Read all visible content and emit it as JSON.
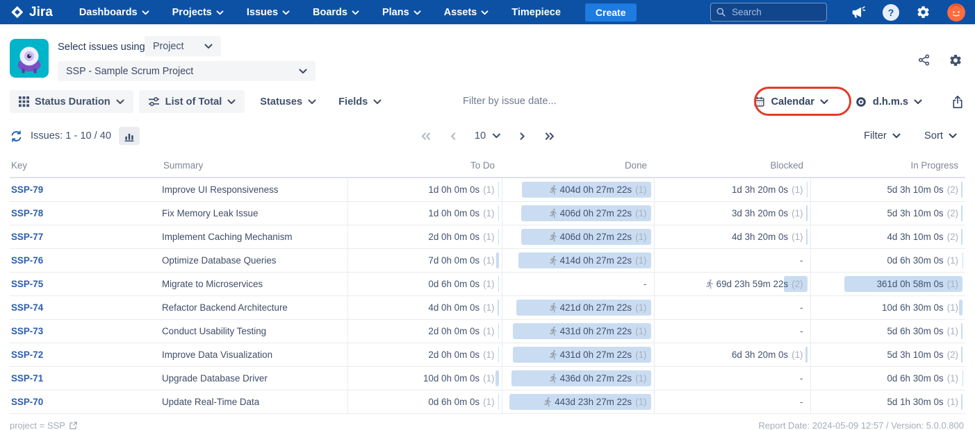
{
  "navbar": {
    "brand": "Jira",
    "items": [
      {
        "label": "Dashboards",
        "chevron": true
      },
      {
        "label": "Projects",
        "chevron": true
      },
      {
        "label": "Issues",
        "chevron": true
      },
      {
        "label": "Boards",
        "chevron": true
      },
      {
        "label": "Plans",
        "chevron": true
      },
      {
        "label": "Assets",
        "chevron": true
      },
      {
        "label": "Timepiece",
        "chevron": false
      }
    ],
    "create_label": "Create",
    "search_placeholder": "Search"
  },
  "selector": {
    "label": "Select issues using",
    "mode_value": "Project",
    "project_value": "SSP - Sample Scrum Project"
  },
  "toolbar": {
    "report_type": "Status Duration",
    "view": "List of Total",
    "statuses": "Statuses",
    "fields": "Fields",
    "date_filter": "Filter by issue date...",
    "calendar": "Calendar",
    "time_format": "d.h.m.s"
  },
  "pager": {
    "issues_label": "Issues: 1 - 10 / 40",
    "page_size": "10",
    "filter": "Filter",
    "sort": "Sort"
  },
  "table": {
    "columns": [
      "Key",
      "Summary",
      "To Do",
      "Done",
      "Blocked",
      "In Progress"
    ],
    "max_days": 444,
    "rows": [
      {
        "key": "SSP-79",
        "summary": "Improve UI Responsiveness",
        "cells": {
          "todo": {
            "text": "1d 0h 0m 0s",
            "count": "(1)",
            "days": 1
          },
          "done": {
            "text": "404d 0h 27m 22s",
            "count": "(1)",
            "days": 404,
            "runner": true
          },
          "blocked": {
            "text": "1d 3h 20m 0s",
            "count": "(1)",
            "days": 1.14
          },
          "inprogress": {
            "text": "5d 3h 10m 0s",
            "count": "(2)",
            "days": 5.13
          }
        }
      },
      {
        "key": "SSP-78",
        "summary": "Fix Memory Leak Issue",
        "cells": {
          "todo": {
            "text": "1d 0h 0m 0s",
            "count": "(1)",
            "days": 1
          },
          "done": {
            "text": "406d 0h 27m 22s",
            "count": "(1)",
            "days": 406,
            "runner": true
          },
          "blocked": {
            "text": "3d 3h 20m 0s",
            "count": "(1)",
            "days": 3.14
          },
          "inprogress": {
            "text": "5d 3h 10m 0s",
            "count": "(2)",
            "days": 5.13
          }
        }
      },
      {
        "key": "SSP-77",
        "summary": "Implement Caching Mechanism",
        "cells": {
          "todo": {
            "text": "2d 0h 0m 0s",
            "count": "(1)",
            "days": 2
          },
          "done": {
            "text": "406d 0h 27m 22s",
            "count": "(1)",
            "days": 406,
            "runner": true
          },
          "blocked": {
            "text": "4d 3h 20m 0s",
            "count": "(1)",
            "days": 4.14
          },
          "inprogress": {
            "text": "4d 3h 10m 0s",
            "count": "(2)",
            "days": 4.13
          }
        }
      },
      {
        "key": "SSP-76",
        "summary": "Optimize Database Queries",
        "cells": {
          "todo": {
            "text": "7d 0h 0m 0s",
            "count": "(1)",
            "days": 7
          },
          "done": {
            "text": "414d 0h 27m 22s",
            "count": "(1)",
            "days": 414,
            "runner": true
          },
          "blocked": "-",
          "inprogress": {
            "text": "0d 6h 30m 0s",
            "count": "(1)",
            "days": 0.27
          }
        }
      },
      {
        "key": "SSP-75",
        "summary": "Migrate to Microservices",
        "cells": {
          "todo": {
            "text": "0d 6h 0m 0s",
            "count": "(1)",
            "days": 0.25
          },
          "done": "-",
          "blocked": {
            "text": "69d 23h 59m 22s",
            "count": "(2)",
            "days": 70,
            "runner": true
          },
          "inprogress": {
            "text": "361d 0h 58m 0s",
            "count": "(1)",
            "days": 361
          }
        }
      },
      {
        "key": "SSP-74",
        "summary": "Refactor Backend Architecture",
        "cells": {
          "todo": {
            "text": "4d 0h 0m 0s",
            "count": "(1)",
            "days": 4
          },
          "done": {
            "text": "421d 0h 27m 22s",
            "count": "(1)",
            "days": 421,
            "runner": true
          },
          "blocked": "-",
          "inprogress": {
            "text": "10d 6h 30m 0s",
            "count": "(1)",
            "days": 10.27
          }
        }
      },
      {
        "key": "SSP-73",
        "summary": "Conduct Usability Testing",
        "cells": {
          "todo": {
            "text": "2d 0h 0m 0s",
            "count": "(1)",
            "days": 2
          },
          "done": {
            "text": "431d 0h 27m 22s",
            "count": "(1)",
            "days": 431,
            "runner": true
          },
          "blocked": "-",
          "inprogress": {
            "text": "5d 6h 30m 0s",
            "count": "(1)",
            "days": 5.27
          }
        }
      },
      {
        "key": "SSP-72",
        "summary": "Improve Data Visualization",
        "cells": {
          "todo": {
            "text": "2d 0h 0m 0s",
            "count": "(1)",
            "days": 2
          },
          "done": {
            "text": "431d 0h 27m 22s",
            "count": "(1)",
            "days": 431,
            "runner": true
          },
          "blocked": {
            "text": "6d 3h 20m 0s",
            "count": "(1)",
            "days": 6.14
          },
          "inprogress": {
            "text": "5d 3h 10m 0s",
            "count": "(2)",
            "days": 5.13
          }
        }
      },
      {
        "key": "SSP-71",
        "summary": "Upgrade Database Driver",
        "cells": {
          "todo": {
            "text": "10d 0h 0m 0s",
            "count": "(1)",
            "days": 10
          },
          "done": {
            "text": "436d 0h 27m 22s",
            "count": "(1)",
            "days": 436,
            "runner": true
          },
          "blocked": "-",
          "inprogress": {
            "text": "0d 6h 30m 0s",
            "count": "(1)",
            "days": 0.27
          }
        }
      },
      {
        "key": "SSP-70",
        "summary": "Update Real-Time Data",
        "cells": {
          "todo": {
            "text": "0d 6h 0m 0s",
            "count": "(1)",
            "days": 0.25
          },
          "done": {
            "text": "443d 23h 27m 22s",
            "count": "(1)",
            "days": 443.98,
            "runner": true
          },
          "blocked": "-",
          "inprogress": {
            "text": "5d 1h 30m 0s",
            "count": "(1)",
            "days": 5.06
          }
        }
      }
    ]
  },
  "footer": {
    "left_text": "project = SSP",
    "right_text": "Report Date: 2024-05-09 12:57 / Version: 5.0.0.800"
  },
  "icons": {
    "runner-icon": "issue currently in this status",
    "calendar-icon": "calendar",
    "target-icon": "time format",
    "export-icon": "export / share report",
    "refresh-icon": "reload issues",
    "bar-chart-icon": "chart view",
    "grid-icon": "report type",
    "sliders-icon": "list view options",
    "share-icon": "share report",
    "gear-icon": "settings",
    "search-icon": "search",
    "megaphone-icon": "announcements",
    "help-icon": "help",
    "external-link-icon": "open JQL in issue navigator"
  },
  "colors": {
    "navbar_bg": "#0d51a4",
    "create_button": "#1e7be0",
    "duration_bar": "#c9dcf1",
    "annotation_red": "#e23b2a",
    "key_link": "#2a5db2",
    "app_tile": "#00b5c9"
  }
}
